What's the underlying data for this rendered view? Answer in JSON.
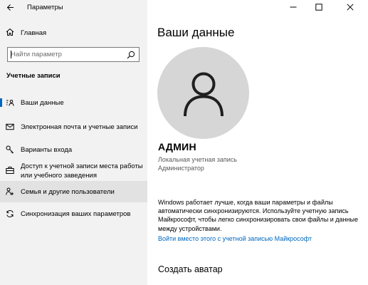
{
  "window": {
    "title": "Параметры"
  },
  "sidebar": {
    "home_label": "Главная",
    "search_placeholder": "Найти параметр",
    "section_label": "Учетные записи",
    "items": [
      {
        "label": "Ваши данные",
        "icon": "user-card-icon",
        "active": true
      },
      {
        "label": "Электронная почта и учетные записи",
        "icon": "mail-icon"
      },
      {
        "label": "Варианты входа",
        "icon": "key-icon"
      },
      {
        "label": "Доступ к учетной записи места работы или учебного заведения",
        "line1": "Доступ к учетной записи места работы",
        "line2": "или учебного заведения",
        "icon": "briefcase-icon"
      },
      {
        "label": "Семья и другие пользователи",
        "icon": "family-icon",
        "hover": true
      },
      {
        "label": "Синхронизация ваших параметров",
        "icon": "sync-icon"
      }
    ]
  },
  "main": {
    "title": "Ваши данные",
    "user_name": "АДМИН",
    "account_type": "Локальная учетная запись",
    "role": "Администратор",
    "sync_text": "Windows работает лучше, когда ваши параметры и файлы автоматически синхронизируются. Используйте учетную запись Майкрософт, чтобы легко синхронизировать свои файлы и данные между устройствами.",
    "ms_link": "Войти вместо этого с учетной записью Майкрософт",
    "avatar_section": "Создать аватар"
  },
  "colors": {
    "accent": "#0067c0",
    "sidebar_bg": "#f2f2f2",
    "hover_bg": "#e2e2e2",
    "avatar_bg": "#d6d6d6"
  }
}
